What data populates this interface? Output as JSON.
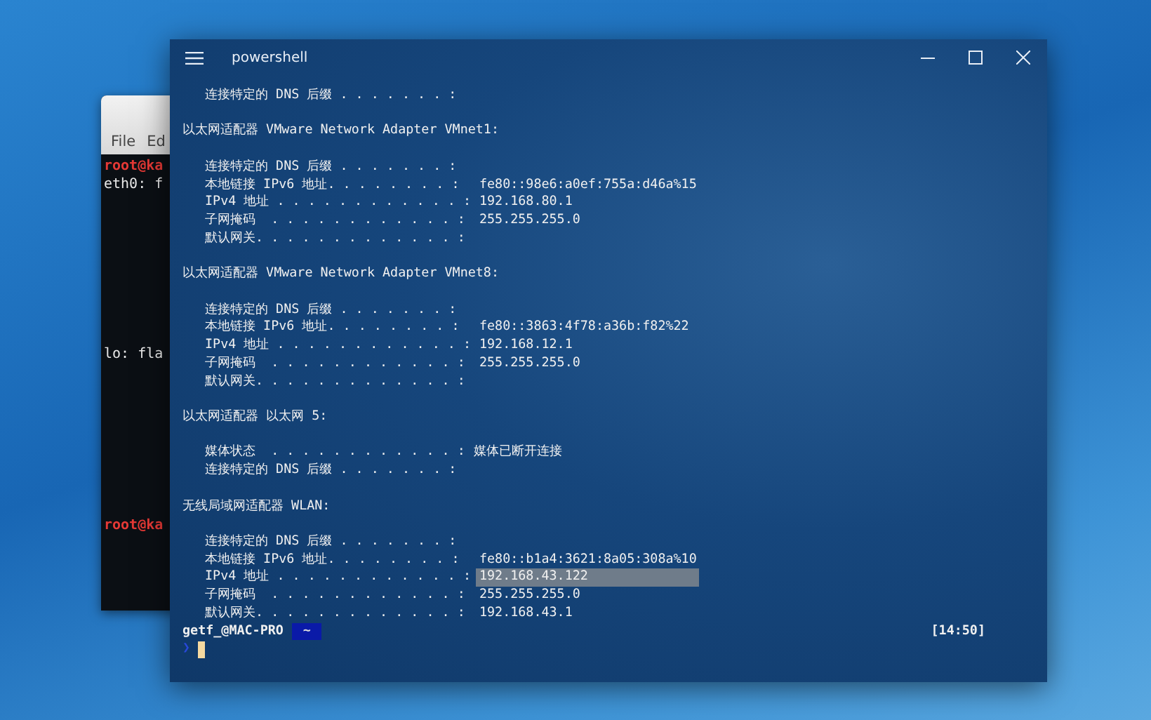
{
  "background_terminal": {
    "menu": [
      "File",
      "Ed"
    ],
    "lines": [
      {
        "kind": "prompt",
        "text": "root@ka"
      },
      {
        "kind": "output",
        "text": "eth0: f"
      },
      {
        "kind": "output",
        "text": "lo: fla"
      },
      {
        "kind": "prompt",
        "text": "root@ka"
      }
    ]
  },
  "window": {
    "title": "powershell"
  },
  "sections": [
    {
      "entries": [
        {
          "label": "连接特定的 DNS 后缀 . . . . . . . :",
          "highlighted": false
        }
      ]
    },
    {
      "heading": "以太网适配器 VMware Network Adapter VMnet1:",
      "entries": [
        {
          "label": "连接特定的 DNS 后缀 . . . . . . . :",
          "highlighted": false
        },
        {
          "label": "本地链接 IPv6 地址. . . . . . . . :",
          "value": "fe80::98e6:a0ef:755a:d46a%15",
          "highlighted": false
        },
        {
          "label": "IPv4 地址 . . . . . . . . . . . . :",
          "value": "192.168.80.1",
          "highlighted": false
        },
        {
          "label": "子网掩码  . . . . . . . . . . . . :",
          "value": "255.255.255.0",
          "highlighted": false
        },
        {
          "label": "默认网关. . . . . . . . . . . . . :",
          "highlighted": false
        }
      ]
    },
    {
      "heading": "以太网适配器 VMware Network Adapter VMnet8:",
      "entries": [
        {
          "label": "连接特定的 DNS 后缀 . . . . . . . :",
          "highlighted": false
        },
        {
          "label": "本地链接 IPv6 地址. . . . . . . . :",
          "value": "fe80::3863:4f78:a36b:f82%22",
          "highlighted": false
        },
        {
          "label": "IPv4 地址 . . . . . . . . . . . . :",
          "value": "192.168.12.1",
          "highlighted": false
        },
        {
          "label": "子网掩码  . . . . . . . . . . . . :",
          "value": "255.255.255.0",
          "highlighted": false
        },
        {
          "label": "默认网关. . . . . . . . . . . . . :",
          "highlighted": false
        }
      ]
    },
    {
      "heading": "以太网适配器 以太网 5:",
      "entries": [
        {
          "label": "媒体状态  . . . . . . . . . . . . :",
          "value": "媒体已断开连接",
          "highlighted": false
        },
        {
          "label": "连接特定的 DNS 后缀 . . . . . . . :",
          "highlighted": false
        }
      ]
    },
    {
      "heading": "无线局域网适配器 WLAN:",
      "entries": [
        {
          "label": "连接特定的 DNS 后缀 . . . . . . . :",
          "highlighted": false
        },
        {
          "label": "本地链接 IPv6 地址. . . . . . . . :",
          "value": "fe80::b1a4:3621:8a05:308a%10",
          "highlighted": false
        },
        {
          "label": "IPv4 地址 . . . . . . . . . . . . :",
          "value": "192.168.43.122",
          "highlighted": true
        },
        {
          "label": "子网掩码  . . . . . . . . . . . . :",
          "value": "255.255.255.0",
          "highlighted": false
        },
        {
          "label": "默认网关. . . . . . . . . . . . . :",
          "value": "192.168.43.1",
          "highlighted": false
        }
      ]
    }
  ],
  "prompt": {
    "user_host": "getf_@MAC-PRO",
    "path": "~",
    "time": "[14:50]",
    "chevron": "❯"
  }
}
